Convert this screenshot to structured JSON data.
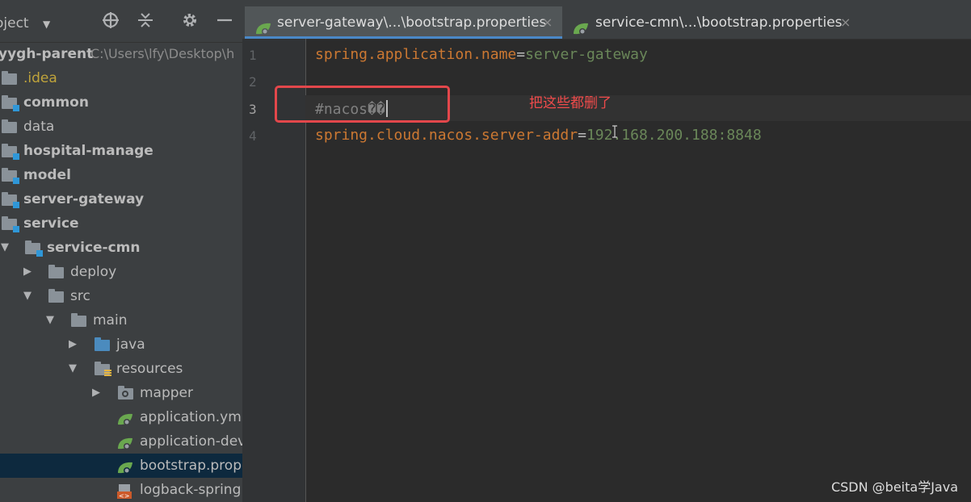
{
  "sidebar": {
    "title": "oject",
    "header_icons": [
      "target-icon",
      "collapse-icon",
      "gear-icon",
      "minimize-icon"
    ],
    "tree": [
      {
        "label": "yygh-parent",
        "path": "C:\\Users\\lfy\\Desktop\\h",
        "type": "root"
      },
      {
        "label": ".idea",
        "type": "folder"
      },
      {
        "label": "common",
        "type": "module"
      },
      {
        "label": "data",
        "type": "folder"
      },
      {
        "label": "hospital-manage",
        "type": "module"
      },
      {
        "label": "model",
        "type": "module"
      },
      {
        "label": "server-gateway",
        "type": "module"
      },
      {
        "label": "service",
        "type": "module"
      },
      {
        "label": "service-cmn",
        "type": "module",
        "expanded": true
      },
      {
        "label": "deploy",
        "type": "folder",
        "expanded": false
      },
      {
        "label": "src",
        "type": "folder",
        "expanded": true
      },
      {
        "label": "main",
        "type": "folder",
        "expanded": true
      },
      {
        "label": "java",
        "type": "source-folder",
        "expanded": false
      },
      {
        "label": "resources",
        "type": "resource-folder",
        "expanded": true
      },
      {
        "label": "mapper",
        "type": "package",
        "expanded": false
      },
      {
        "label": "application.yml",
        "type": "spring-file"
      },
      {
        "label": "application-dev",
        "type": "spring-file"
      },
      {
        "label": "bootstrap.properties",
        "type": "spring-file",
        "selected": true
      },
      {
        "label": "logback-spring.",
        "type": "xml-file"
      }
    ]
  },
  "tabs": [
    {
      "label": "server-gateway\\...\\bootstrap.properties",
      "active": true,
      "close": "×"
    },
    {
      "label": "service-cmn\\...\\bootstrap.properties",
      "active": false,
      "close": "×"
    }
  ],
  "editor": {
    "line_numbers": [
      "1",
      "2",
      "3",
      "4"
    ],
    "lines": [
      {
        "key": "spring.application.name",
        "eq": "=",
        "value": "server-gateway"
      },
      {
        "key": "",
        "eq": "",
        "value": ""
      },
      {
        "comment": "#nacos��"
      },
      {
        "key": "spring.cloud.nacos.server-addr",
        "eq": "=",
        "value": "192.168.200.188:8848"
      }
    ]
  },
  "annotation": {
    "text": "把这些都删了",
    "color": "#e3474b"
  },
  "watermark": "CSDN @beita学Java",
  "colors": {
    "key": "#cc7832",
    "value": "#6a8759",
    "comment": "#808080",
    "selection": "#0d293e"
  }
}
